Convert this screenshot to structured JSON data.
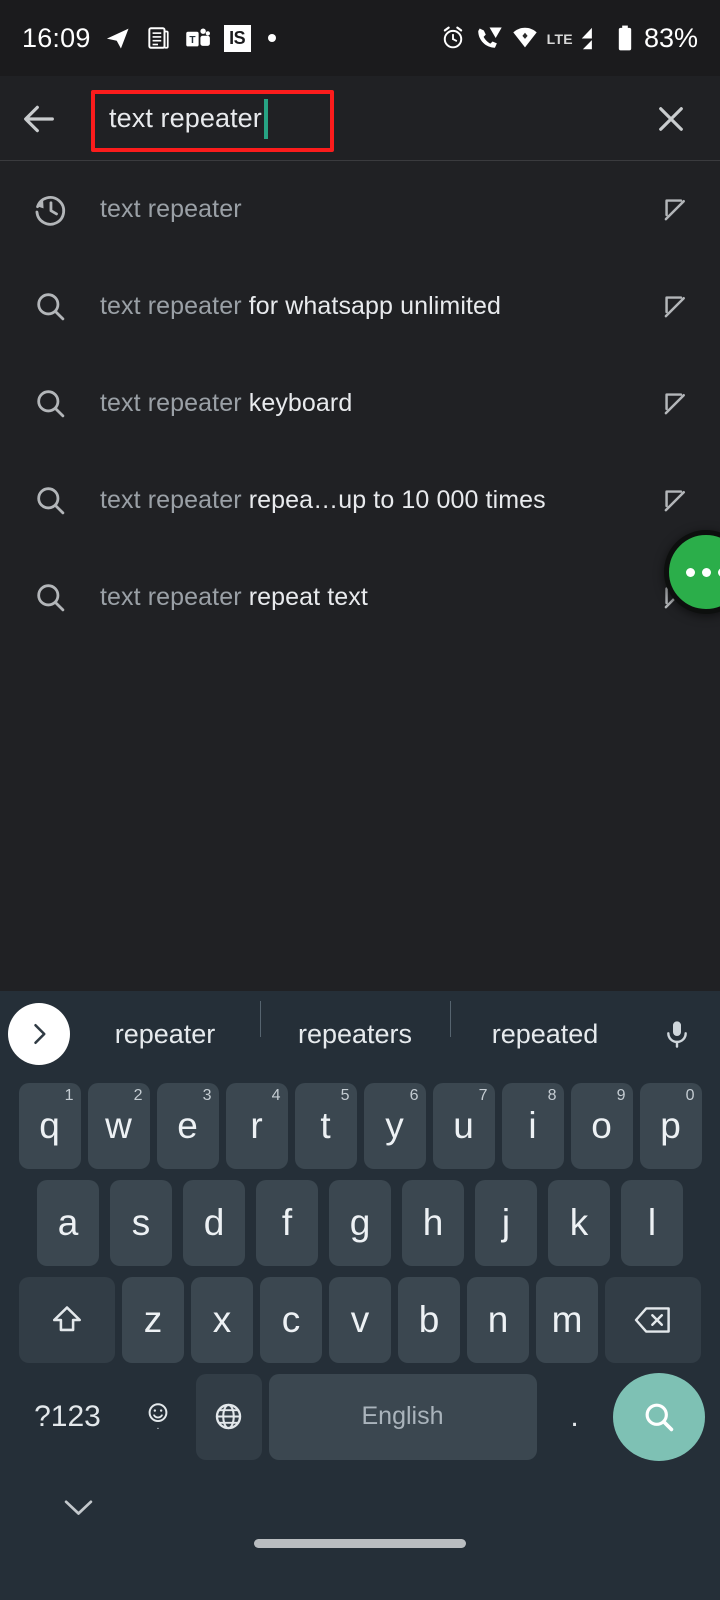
{
  "status_bar": {
    "time": "16:09",
    "battery_percent": "83%",
    "network_label": "LTE",
    "app_badge_label": "IS",
    "left_icons": [
      "telegram-icon",
      "news-reader-icon",
      "ms-teams-icon",
      "is-badge-icon",
      "notification-dot-icon"
    ],
    "right_icons": [
      "alarm-icon",
      "wifi-calling-icon",
      "wifi-icon",
      "lte-label",
      "signal-bars-icon",
      "battery-icon"
    ]
  },
  "search_header": {
    "back_icon": "arrow-left-icon",
    "query": "text repeater",
    "clear_icon": "close-icon",
    "highlight_color": "#fb1c1c",
    "caret_color": "#27a383"
  },
  "suggestions": [
    {
      "icon": "history-icon",
      "prefix": "text repeater",
      "completion": "",
      "arrow": "arrow-up-left-icon"
    },
    {
      "icon": "search-icon",
      "prefix": "text repeater",
      "completion": " for whatsapp unlimited",
      "arrow": "arrow-up-left-icon"
    },
    {
      "icon": "search-icon",
      "prefix": "text repeater",
      "completion": " keyboard",
      "arrow": "arrow-up-left-icon"
    },
    {
      "icon": "search-icon",
      "prefix": "text repeater",
      "completion": " repea…up to 10 000 times",
      "arrow": "arrow-up-left-icon"
    },
    {
      "icon": "search-icon",
      "prefix": "text repeater",
      "completion": " repeat text",
      "arrow": "arrow-up-left-icon"
    }
  ],
  "floating_bubble": {
    "name": "chat-bubble-overlay",
    "color": "#2bae4a",
    "dots": 3
  },
  "keyboard": {
    "expand_icon": "chevron-right-icon",
    "mic_icon": "microphone-icon",
    "suggestions": [
      "repeater",
      "repeaters",
      "repeated"
    ],
    "row1": [
      {
        "label": "q",
        "num": "1"
      },
      {
        "label": "w",
        "num": "2"
      },
      {
        "label": "e",
        "num": "3"
      },
      {
        "label": "r",
        "num": "4"
      },
      {
        "label": "t",
        "num": "5"
      },
      {
        "label": "y",
        "num": "6"
      },
      {
        "label": "u",
        "num": "7"
      },
      {
        "label": "i",
        "num": "8"
      },
      {
        "label": "o",
        "num": "9"
      },
      {
        "label": "p",
        "num": "0"
      }
    ],
    "row2": [
      "a",
      "s",
      "d",
      "f",
      "g",
      "h",
      "j",
      "k",
      "l"
    ],
    "row3_letters": [
      "z",
      "x",
      "c",
      "v",
      "b",
      "n",
      "m"
    ],
    "shift_icon": "shift-icon",
    "backspace_icon": "backspace-icon",
    "symbols_label": "?123",
    "emoji_icon": "emoji-icon",
    "emoji_secondary": ",",
    "globe_icon": "language-globe-icon",
    "space_label": "English",
    "period_label": ".",
    "enter_icon": "search-icon",
    "enter_color": "#7ec1b4",
    "hide_icon": "chevron-down-icon"
  }
}
